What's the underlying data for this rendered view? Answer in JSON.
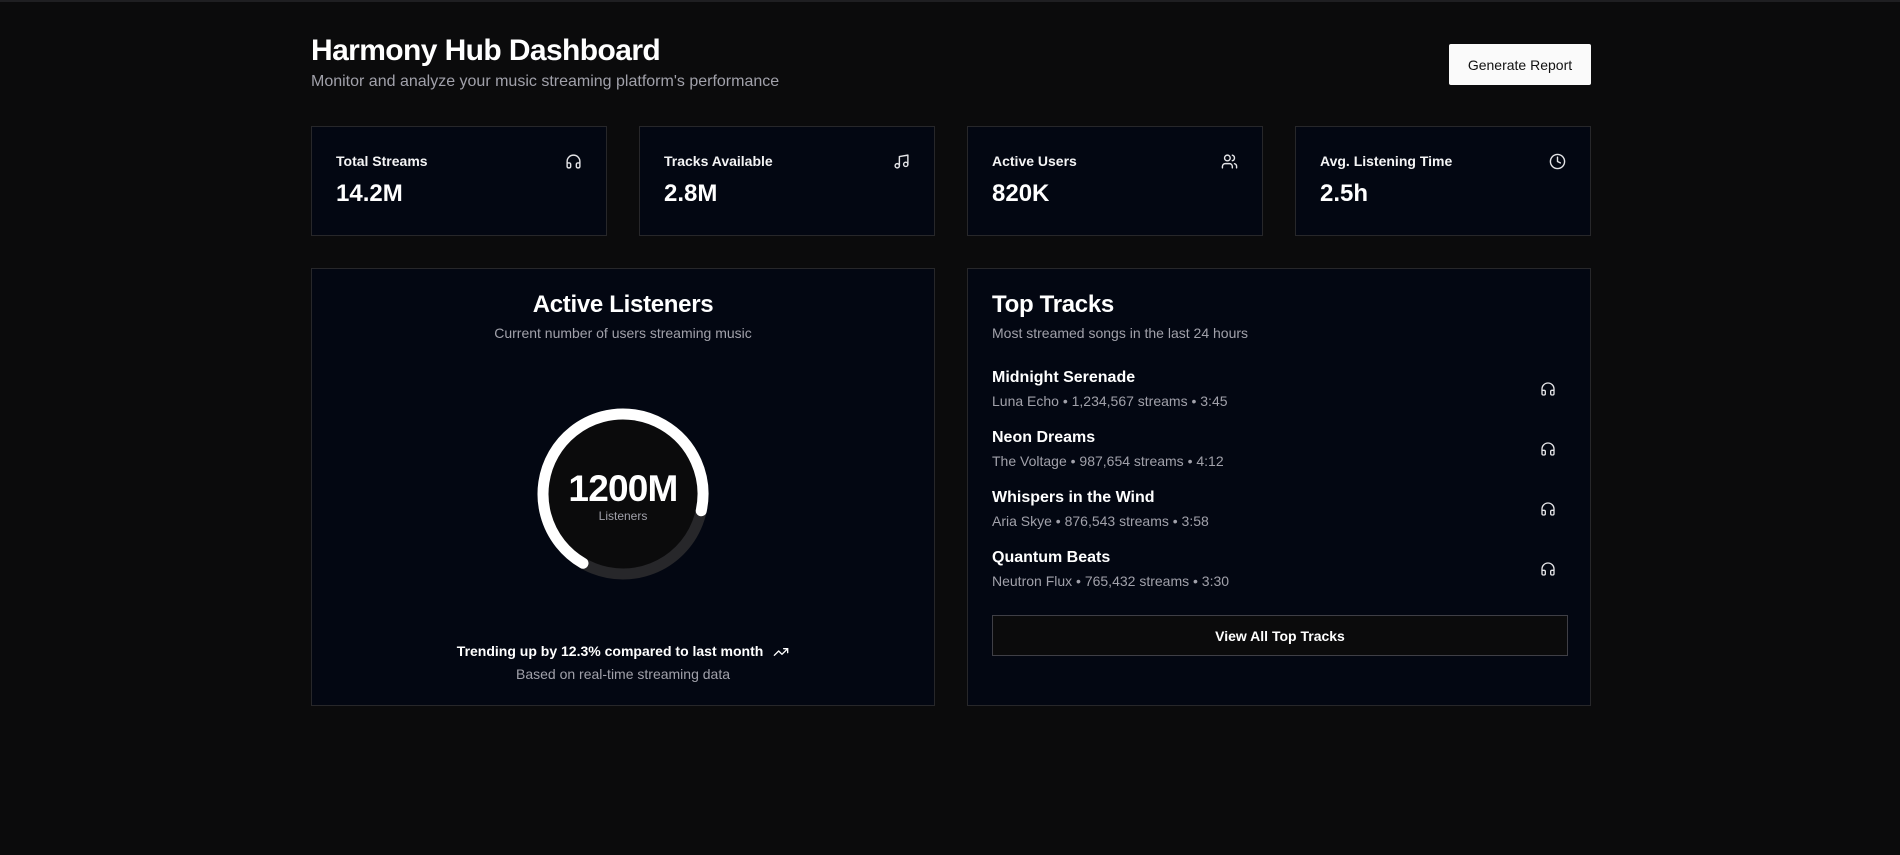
{
  "header": {
    "title": "Harmony Hub Dashboard",
    "subtitle": "Monitor and analyze your music streaming platform's performance",
    "report_button": "Generate Report"
  },
  "stats": [
    {
      "label": "Total Streams",
      "value": "14.2M",
      "icon": "headphones-icon"
    },
    {
      "label": "Tracks Available",
      "value": "2.8M",
      "icon": "music-note-icon"
    },
    {
      "label": "Active Users",
      "value": "820K",
      "icon": "users-icon"
    },
    {
      "label": "Avg. Listening Time",
      "value": "2.5h",
      "icon": "clock-icon"
    }
  ],
  "listeners": {
    "title": "Active Listeners",
    "description": "Current number of users streaming music",
    "value": "1200M",
    "value_label": "Listeners",
    "gauge_fill_fraction": 0.7,
    "trend": "Trending up by 12.3% compared to last month",
    "trend_icon": "trending-up-icon",
    "note": "Based on real-time streaming data"
  },
  "top_tracks": {
    "title": "Top Tracks",
    "description": "Most streamed songs in the last 24 hours",
    "tracks": [
      {
        "name": "Midnight Serenade",
        "meta": "Luna Echo • 1,234,567 streams • 3:45"
      },
      {
        "name": "Neon Dreams",
        "meta": "The Voltage • 987,654 streams • 4:12"
      },
      {
        "name": "Whispers in the Wind",
        "meta": "Aria Skye • 876,543 streams • 3:58"
      },
      {
        "name": "Quantum Beats",
        "meta": "Neutron Flux • 765,432 streams • 3:30"
      }
    ],
    "view_all": "View All Top Tracks"
  },
  "colors": {
    "background": "#0b0b0c",
    "card": "#030712",
    "border": "#27272a",
    "muted_text": "#a1a1aa",
    "gauge_track": "#27272a",
    "gauge_fill": "#ffffff"
  }
}
